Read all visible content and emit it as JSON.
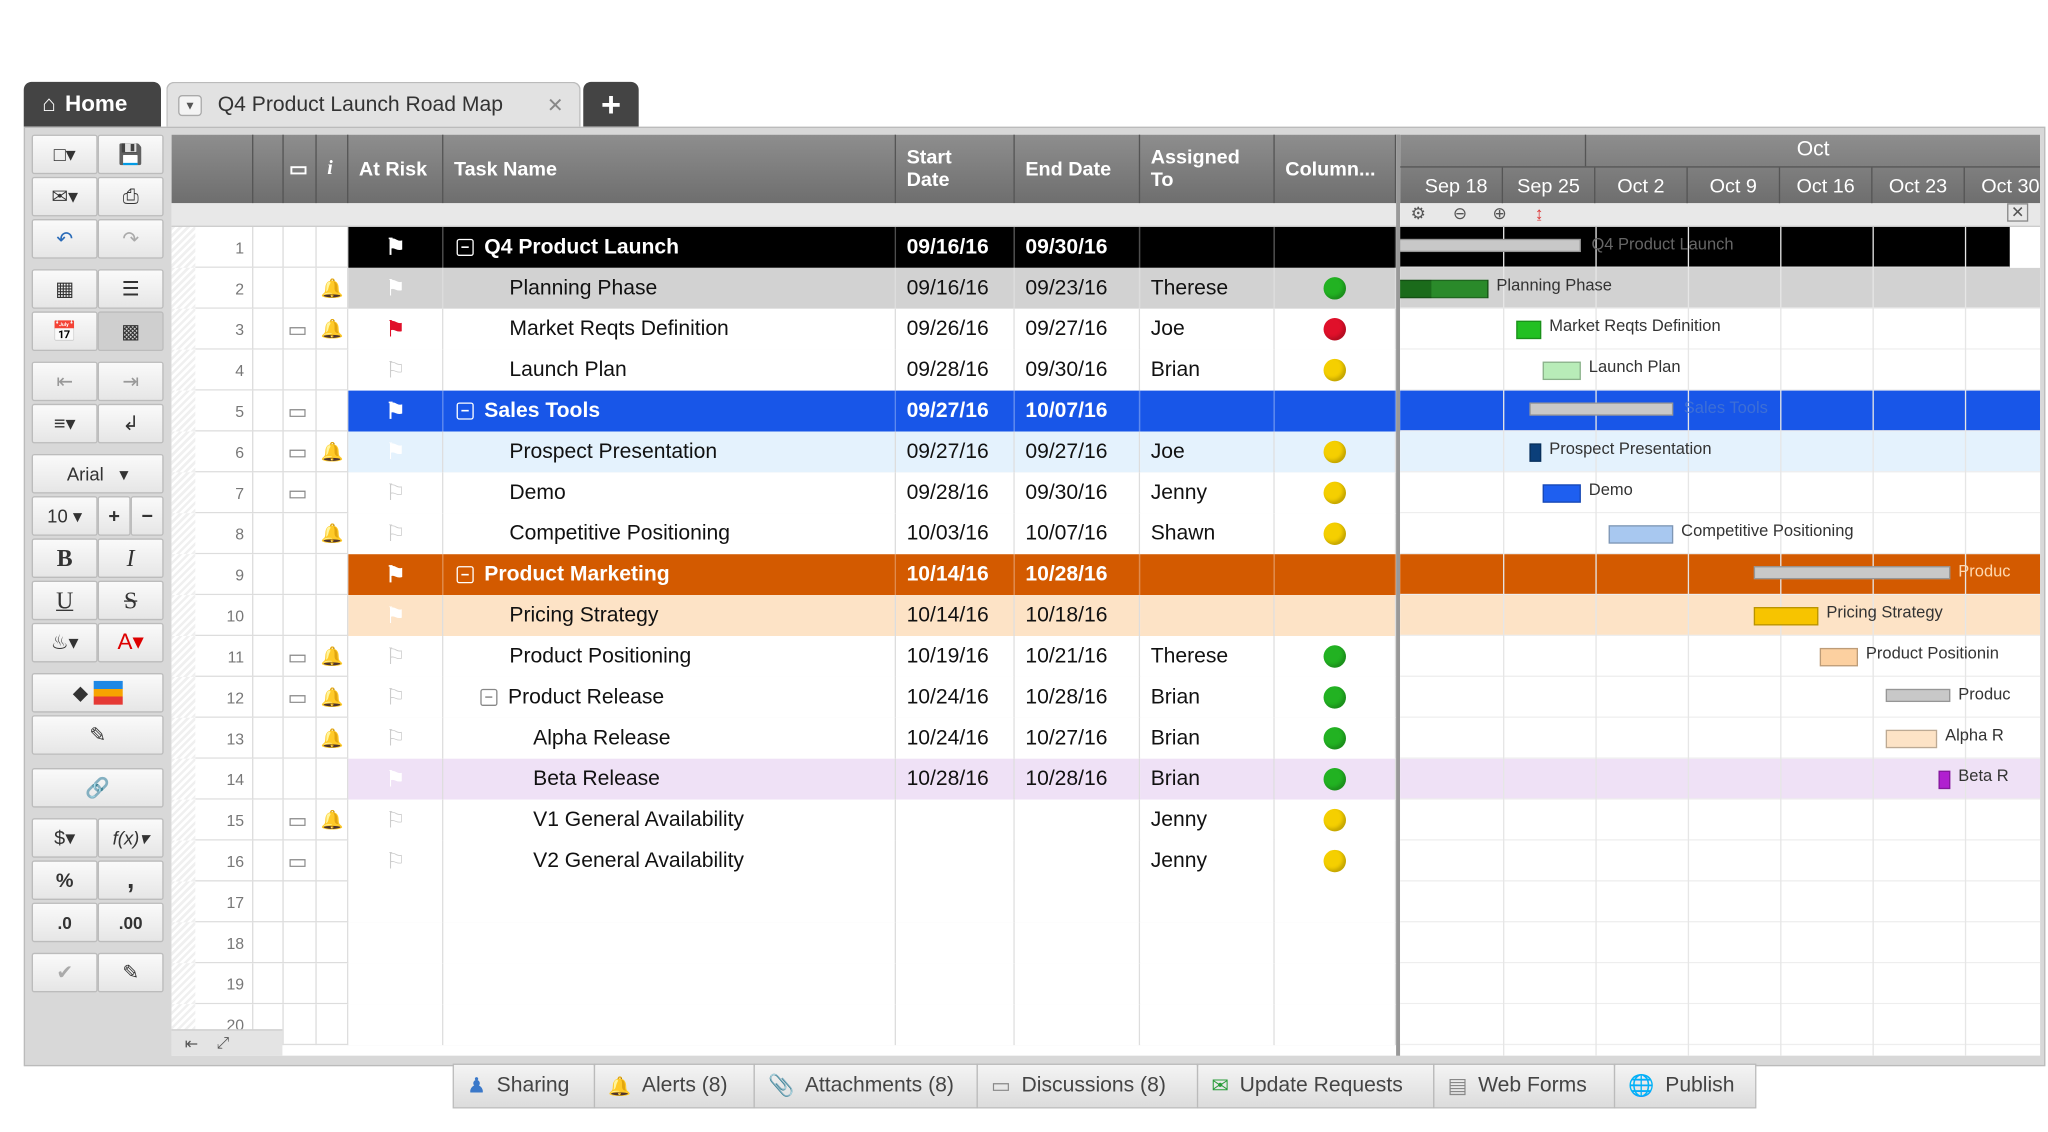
{
  "tabs": {
    "home": "Home",
    "doc": "Q4 Product Launch Road Map",
    "add": "+"
  },
  "toolbar": {
    "font": "Arial",
    "size": "10",
    "bold": "B",
    "italic": "I",
    "underline": "U",
    "strike": "S",
    "currency": "$",
    "fx": "f(x)",
    "percent": "%",
    "comma": ",",
    "dec_up": ".0",
    "dec_down": ".00"
  },
  "headers": [
    "At Risk",
    "Task Name",
    "Start Date",
    "End Date",
    "Assigned To",
    "Column..."
  ],
  "header_sub": {
    "start": [
      "Start",
      "Date"
    ],
    "assigned": [
      "Assigned",
      "To"
    ]
  },
  "rows": [
    {
      "n": "1",
      "task": "Q4 Product Launch",
      "start": "09/16/16",
      "end": "09/30/16",
      "who": "",
      "status": "",
      "parent": true,
      "color": "#000000",
      "flag": "white"
    },
    {
      "n": "2",
      "task": "Planning Phase",
      "start": "09/16/16",
      "end": "09/23/16",
      "who": "Therese",
      "status": "green",
      "bell": true,
      "bg": "#d2d2d2",
      "flag": "light"
    },
    {
      "n": "3",
      "task": "Market Reqts Definition",
      "start": "09/26/16",
      "end": "09/27/16",
      "who": "Joe",
      "status": "red",
      "bell": true,
      "comment": true,
      "flag": "red"
    },
    {
      "n": "4",
      "task": "Launch Plan",
      "start": "09/28/16",
      "end": "09/30/16",
      "who": "Brian",
      "status": "yellow",
      "flag": "empty"
    },
    {
      "n": "5",
      "task": "Sales Tools",
      "start": "09/27/16",
      "end": "10/07/16",
      "who": "",
      "status": "",
      "parent": true,
      "color": "#1856e8",
      "flag": "white",
      "comment": true
    },
    {
      "n": "6",
      "task": "Prospect Presentation",
      "start": "09/27/16",
      "end": "09/27/16",
      "who": "Joe",
      "status": "yellow",
      "bell": true,
      "comment": true,
      "bg": "#e4f2fd",
      "flag": "light"
    },
    {
      "n": "7",
      "task": "Demo",
      "start": "09/28/16",
      "end": "09/30/16",
      "who": "Jenny",
      "status": "yellow",
      "comment": true,
      "flag": "empty"
    },
    {
      "n": "8",
      "task": "Competitive Positioning",
      "start": "10/03/16",
      "end": "10/07/16",
      "who": "Shawn",
      "status": "yellow",
      "bell": true,
      "flag": "empty"
    },
    {
      "n": "9",
      "task": "Product Marketing",
      "start": "10/14/16",
      "end": "10/28/16",
      "who": "",
      "status": "",
      "parent": true,
      "color": "#d35a00",
      "flag": "white"
    },
    {
      "n": "10",
      "task": "Pricing Strategy",
      "start": "10/14/16",
      "end": "10/18/16",
      "who": "",
      "status": "",
      "bg": "#fde3c6",
      "flag": "light"
    },
    {
      "n": "11",
      "task": "Product Positioning",
      "start": "10/19/16",
      "end": "10/21/16",
      "who": "Therese",
      "status": "green",
      "bell": true,
      "comment": true,
      "flag": "empty"
    },
    {
      "n": "12",
      "task": "Product Release",
      "start": "10/24/16",
      "end": "10/28/16",
      "who": "Brian",
      "status": "green",
      "bell": true,
      "comment": true,
      "flag": "empty",
      "sub": true
    },
    {
      "n": "13",
      "task": "Alpha Release",
      "start": "10/24/16",
      "end": "10/27/16",
      "who": "Brian",
      "status": "green",
      "bell": true,
      "flag": "empty",
      "indent2": true
    },
    {
      "n": "14",
      "task": "Beta Release",
      "start": "10/28/16",
      "end": "10/28/16",
      "who": "Brian",
      "status": "green",
      "bg": "#efe1f6",
      "flag": "light",
      "indent2": true
    },
    {
      "n": "15",
      "task": "V1 General Availability",
      "start": "",
      "end": "",
      "who": "Jenny",
      "status": "yellow",
      "bell": true,
      "comment": true,
      "flag": "empty",
      "indent2": true
    },
    {
      "n": "16",
      "task": "V2 General Availability",
      "start": "",
      "end": "",
      "who": "Jenny",
      "status": "yellow",
      "comment": true,
      "flag": "empty",
      "indent2": true
    },
    {
      "n": "17"
    },
    {
      "n": "18"
    },
    {
      "n": "19"
    },
    {
      "n": "20"
    }
  ],
  "gantt": {
    "months": [
      "Oct"
    ],
    "weeks": [
      "Sep 18",
      "Sep 25",
      "Oct 2",
      "Oct 9",
      "Oct 16",
      "Oct 23",
      "Oct 30"
    ],
    "labels": [
      "Q4 Product Launch",
      "Planning Phase",
      "Market Reqts Definition",
      "Launch Plan",
      "Sales Tools",
      "Prospect Presentation",
      "Demo",
      "Competitive Positioning",
      "Produc",
      "Pricing Strategy",
      "Product Positionin",
      "Produc",
      "Alpha R",
      "Beta R"
    ]
  },
  "bottom_tabs": [
    "Sharing",
    "Alerts (8)",
    "Attachments (8)",
    "Discussions (8)",
    "Update Requests",
    "Web Forms",
    "Publish"
  ],
  "colors": {
    "green": "#22b222",
    "red": "#e0102a",
    "yellow": "#f5cf00"
  }
}
